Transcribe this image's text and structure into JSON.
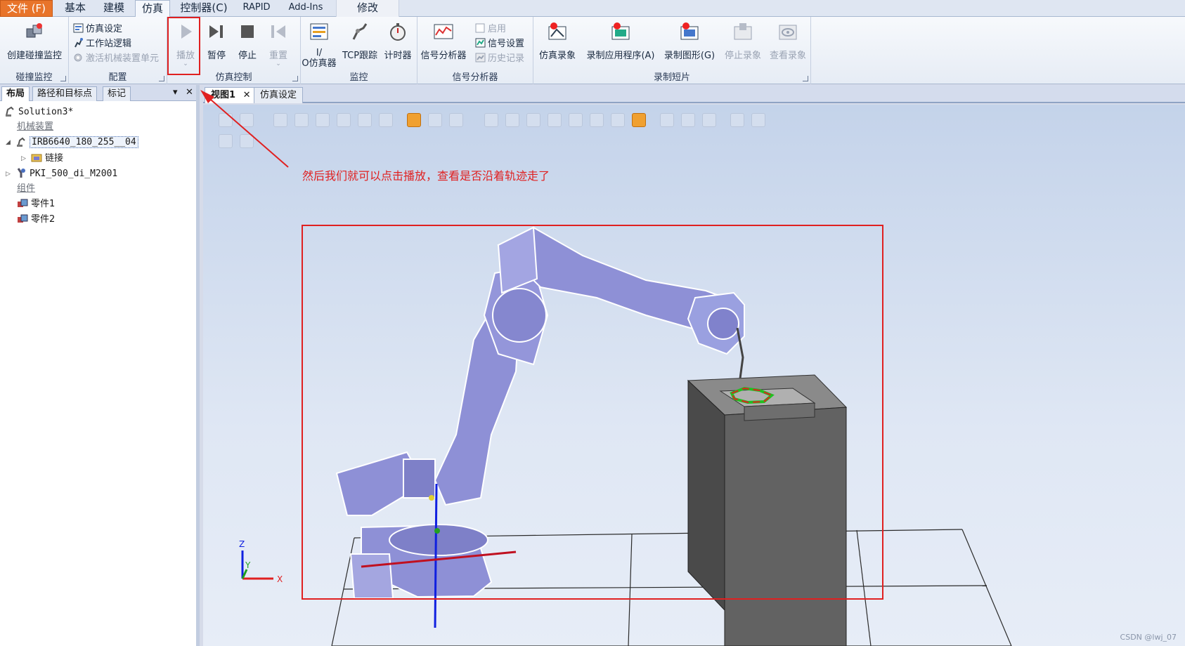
{
  "tabs": {
    "file": "文件 (F)",
    "home": "基本",
    "modeling": "建模",
    "simulation": "仿真",
    "controller": "控制器(C)",
    "rapid": "RAPID",
    "addins": "Add-Ins",
    "modify": "修改"
  },
  "ribbon": {
    "collision": {
      "create": "创建碰撞监控",
      "group": "碰撞监控"
    },
    "config": {
      "sim_setup": "仿真设定",
      "station_logic": "工作站逻辑",
      "activate_mech": "激活机械装置单元",
      "group": "配置"
    },
    "sim_control": {
      "play": "播放",
      "pause": "暂停",
      "stop": "停止",
      "reset": "重置",
      "group": "仿真控制"
    },
    "monitor": {
      "io_line1": "I/",
      "io_line2": "O仿真器",
      "tcp": "TCP跟踪",
      "timer": "计时器",
      "group": "监控"
    },
    "signal": {
      "analyzer": "信号分析器",
      "enable": "启用",
      "settings": "信号设置",
      "history": "历史记录",
      "group": "信号分析器"
    },
    "record": {
      "sim_record": "仿真录象",
      "record_app": "录制应用程序(A)",
      "record_graphics": "录制图形(G)",
      "stop_record": "停止录象",
      "view_record": "查看录象",
      "group": "录制短片"
    }
  },
  "left_panel": {
    "tabs": [
      "布局",
      "路径和目标点",
      "标记"
    ],
    "tree": {
      "solution": "Solution3*",
      "mechanisms_header": "机械装置",
      "robot": "IRB6640_180_255__04",
      "links": "链接",
      "tool": "PKI_500_di_M2001",
      "components_header": "组件",
      "part1": "零件1",
      "part2": "零件2"
    }
  },
  "view_tabs": [
    "视图1",
    "仿真设定"
  ],
  "annotation": "然后我们就可以点击播放，查看是否沿着轨迹走了",
  "axes": {
    "z": "Z",
    "y": "Y",
    "x": "X"
  },
  "watermark": "CSDN @lwj_07",
  "colors": {
    "file_tab": "#e8742a",
    "annotation": "#e02020",
    "robot": "#8e90d6",
    "path_red": "#e02020",
    "path_green": "#20c020"
  }
}
